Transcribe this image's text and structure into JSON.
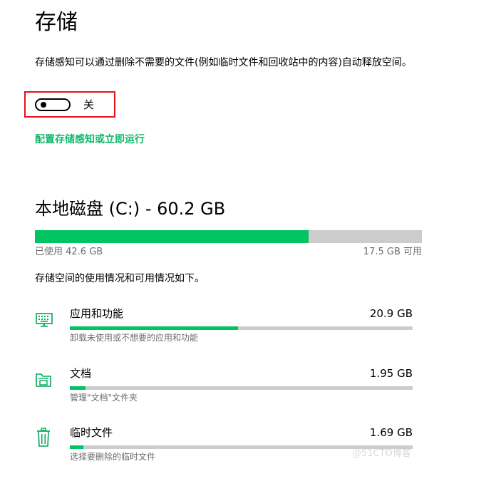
{
  "page": {
    "title": "存储",
    "description": "存储感知可以通过删除不需要的文件(例如临时文件和回收站中的内容)自动释放空间。",
    "toggle_state": "关",
    "toggle_on": false,
    "configure_link": "配置存储感知或立即运行"
  },
  "drive": {
    "title": "本地磁盘 (C:) - 60.2 GB",
    "used_label": "已使用 42.6 GB",
    "free_label": "17.5 GB 可用",
    "used_fraction": 0.708,
    "usage_description": "存储空间的使用情况和可用情况如下。"
  },
  "categories": [
    {
      "icon": "keyboard-icon",
      "name": "应用和功能",
      "size": "20.9 GB",
      "fraction": 0.49,
      "subtitle": "卸载未使用或不想要的应用和功能"
    },
    {
      "icon": "folder-icon",
      "name": "文档",
      "size": "1.95 GB",
      "fraction": 0.045,
      "subtitle": "管理\"文档\"文件夹"
    },
    {
      "icon": "trash-icon",
      "name": "临时文件",
      "size": "1.69 GB",
      "fraction": 0.04,
      "subtitle": "选择要删除的临时文件"
    }
  ],
  "colors": {
    "accent": "#00c462",
    "link": "#10b96a",
    "bar_background": "#cccccc",
    "secondary_text": "#6d6d6d",
    "highlight_border": "#e3121c"
  },
  "watermark": "@51CTO博客"
}
